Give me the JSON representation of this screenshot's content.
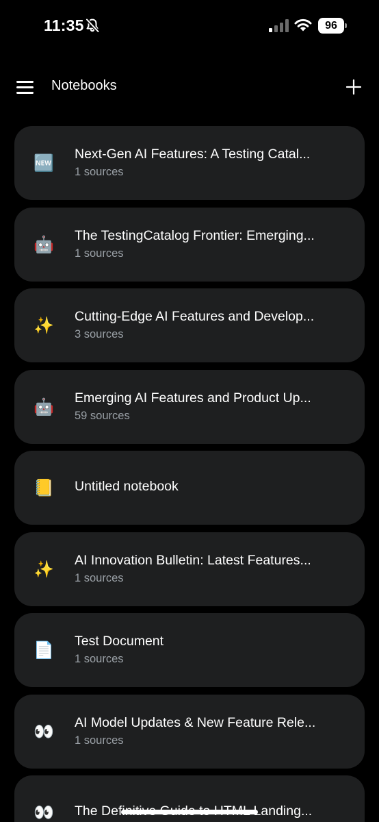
{
  "status": {
    "time": "11:35",
    "battery": "96"
  },
  "header": {
    "title": "Notebooks"
  },
  "notebooks": [
    {
      "emoji": "🆕",
      "icon": "new-badge-icon",
      "title": "Next-Gen AI Features: A Testing Catal...",
      "sources": "1 sources"
    },
    {
      "emoji": "🤖",
      "icon": "robot-icon",
      "title": "The TestingCatalog Frontier: Emerging...",
      "sources": "1 sources"
    },
    {
      "emoji": "✨",
      "icon": "sparkles-icon",
      "title": "Cutting-Edge AI Features and Develop...",
      "sources": "3 sources"
    },
    {
      "emoji": "🤖",
      "icon": "robot-icon",
      "title": "Emerging AI Features and Product Up...",
      "sources": "59 sources"
    },
    {
      "emoji": "📒",
      "icon": "ledger-icon",
      "title": "Untitled notebook",
      "sources": ""
    },
    {
      "emoji": "✨",
      "icon": "sparkles-icon",
      "title": "AI Innovation Bulletin: Latest Features...",
      "sources": "1 sources"
    },
    {
      "emoji": "📄",
      "icon": "document-icon",
      "title": "Test Document",
      "sources": "1 sources"
    },
    {
      "emoji": "👀",
      "icon": "eyes-icon",
      "title": "AI Model Updates & New Feature Rele...",
      "sources": "1 sources"
    },
    {
      "emoji": "👀",
      "icon": "eyes-icon",
      "title": "The Definitive Guide to HTML Landing...",
      "sources": ""
    }
  ]
}
